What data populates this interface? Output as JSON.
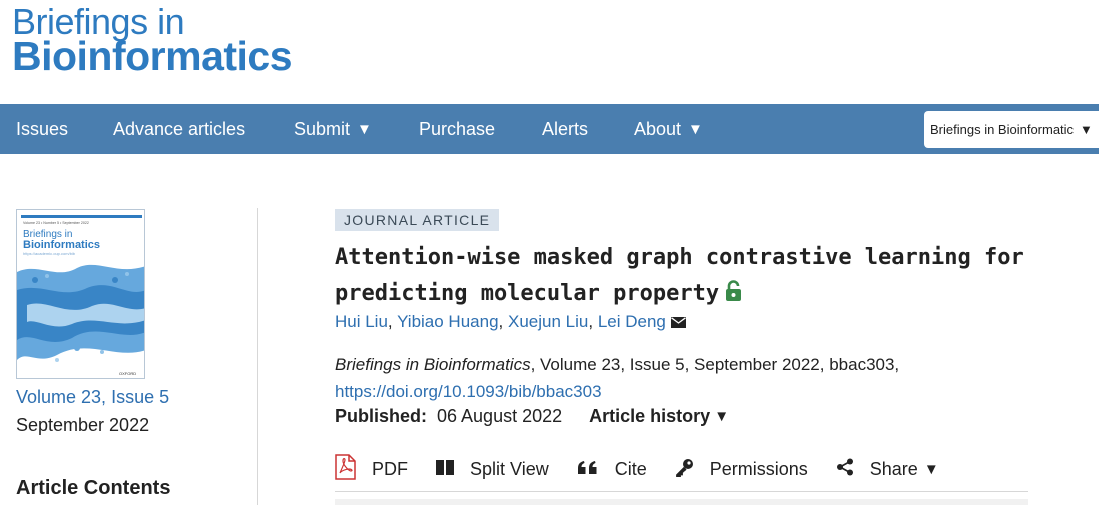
{
  "header": {
    "logo_line1": "Briefings in",
    "logo_line2": "Bioinformatics"
  },
  "nav": {
    "items": [
      {
        "label": "Issues",
        "has_caret": false
      },
      {
        "label": "Advance articles",
        "has_caret": false
      },
      {
        "label": "Submit",
        "has_caret": true
      },
      {
        "label": "Purchase",
        "has_caret": false
      },
      {
        "label": "Alerts",
        "has_caret": false
      },
      {
        "label": "About",
        "has_caret": true
      }
    ],
    "caret": "▼",
    "journal_select": "Briefings in Bioinformatics"
  },
  "cover": {
    "meta": "Volume 23 • Number 5 • September 2022",
    "title_line1": "Briefings in",
    "title_line2": "Bioinformatics",
    "url": "https://academic.oup.com/bib",
    "publisher": "OXFORD"
  },
  "sidebar": {
    "volume_issue": "Volume 23, Issue 5",
    "issue_date": "September 2022",
    "contents_heading": "Article Contents"
  },
  "article": {
    "type_badge": "JOURNAL ARTICLE",
    "title": "Attention-wise masked graph contrastive learning for predicting molecular property",
    "authors": [
      "Hui Liu",
      "Yibiao Huang",
      "Xuejun Liu",
      "Lei Deng"
    ],
    "author_sep": ",",
    "journal_name": "Briefings in Bioinformatics",
    "citation_rest": ", Volume 23, Issue 5, September 2022, bbac303,",
    "doi": "https://doi.org/10.1093/bib/bbac303",
    "published_label": "Published:",
    "published_date": "06 August 2022",
    "history_label": "Article history",
    "history_caret": "▼"
  },
  "toolbar": {
    "pdf": "PDF",
    "split_view": "Split View",
    "cite": "Cite",
    "permissions": "Permissions",
    "share": "Share",
    "share_caret": "▼"
  },
  "colors": {
    "brand_blue": "#2e7bc0",
    "nav_bg": "#4a7eaf",
    "link": "#2e6fb0",
    "open_access_green": "#3a8a4a",
    "pdf_red": "#c33"
  },
  "icons": [
    "pdf-icon",
    "split-view-icon",
    "quote-icon",
    "key-icon",
    "share-icon",
    "open-access-lock-icon",
    "mail-icon"
  ]
}
